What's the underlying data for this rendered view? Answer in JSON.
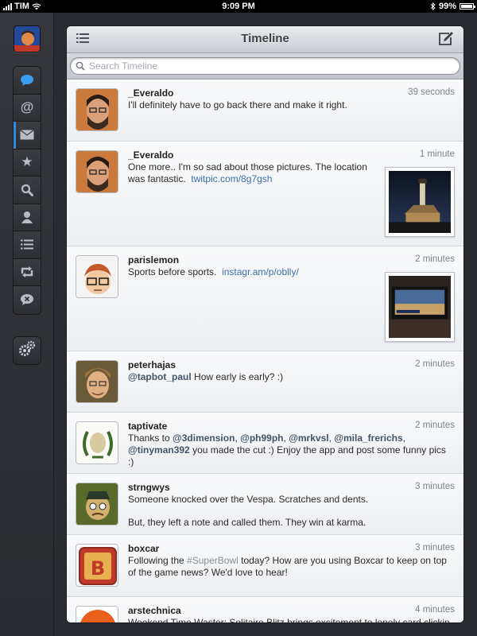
{
  "status_bar": {
    "carrier": "TIM",
    "time": "9:09 PM",
    "battery": "99%",
    "battery_level": 0.99
  },
  "sidebar": {
    "items": [
      {
        "name": "timeline",
        "icon": "speech-bubble-icon"
      },
      {
        "name": "mentions",
        "icon": "at-sign-icon"
      },
      {
        "name": "messages",
        "icon": "envelope-icon"
      },
      {
        "name": "favorites",
        "icon": "star-icon"
      },
      {
        "name": "search",
        "icon": "magnifier-icon"
      },
      {
        "name": "profile",
        "icon": "person-icon"
      },
      {
        "name": "lists",
        "icon": "list-icon"
      },
      {
        "name": "retweets",
        "icon": "retweet-icon"
      },
      {
        "name": "mute",
        "icon": "mute-bubble-icon"
      }
    ],
    "selected": "messages",
    "accent_color": "#2d8ce6"
  },
  "header": {
    "title": "Timeline"
  },
  "search": {
    "placeholder": "Search Timeline"
  },
  "tweets": [
    {
      "user": "_Everaldo",
      "time": "39 seconds",
      "text": "I'll definitely have to go back there and make it right."
    },
    {
      "user": "_Everaldo",
      "time": "1 minute",
      "text": "One more.. I'm so sad about those pictures. The location was fantastic.",
      "link": "twitpic.com/8g7gsh"
    },
    {
      "user": "parislemon",
      "time": "2 minutes",
      "text": "Sports before sports.",
      "link": "instagr.am/p/oblly/"
    },
    {
      "user": "peterhajas",
      "time": "2 minutes",
      "mention": "@tapbot_paul",
      "text": "How early is early? :)"
    },
    {
      "user": "taptivate",
      "time": "2 minutes",
      "text_a": "Thanks to",
      "mentions": [
        "@3dimension",
        "@ph99ph",
        "@mrkvsl",
        "@mila_frerichs",
        "@tinyman392"
      ],
      "sep": ",",
      "text_b": "you made the cut :) Enjoy the app and post some funny pics :)"
    },
    {
      "user": "strngwys",
      "time": "3 minutes",
      "text": "Someone knocked over the Vespa. Scratches and dents.",
      "text2": "But, they left a note and called them. They win at karma."
    },
    {
      "user": "boxcar",
      "time": "3 minutes",
      "text_a": "Following the",
      "hashtag": "#SuperBowl",
      "text_b": "today? How are you using Boxcar to keep on top of the game news? We'd love to hear!"
    },
    {
      "user": "arstechnica",
      "time": "4 minutes",
      "text": "Weekend Time Waster: Solitaire Blitz brings excitement to lonely card clicking:"
    }
  ]
}
